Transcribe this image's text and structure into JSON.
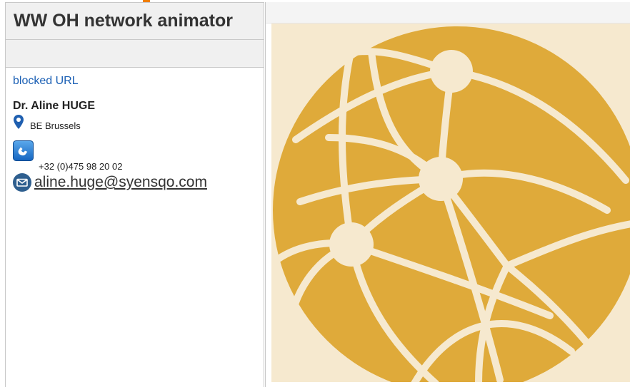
{
  "header": {
    "title": "WW OH network animator"
  },
  "profile": {
    "link_text": "blocked URL",
    "name": "Dr. Aline HUGE",
    "location": "BE Brussels",
    "phone": "+32 (0)475 98 20 02",
    "email": "aline.huge@syensqo.com"
  },
  "icons": {
    "location": "map-pin-icon",
    "phone": "phone-icon",
    "email": "email-icon",
    "image": "network-globe-image"
  },
  "colors": {
    "accent": "#f07d00",
    "globe": "#dfaa3a",
    "globe_background": "#f6e9cf",
    "link": "#1a5fb4"
  }
}
